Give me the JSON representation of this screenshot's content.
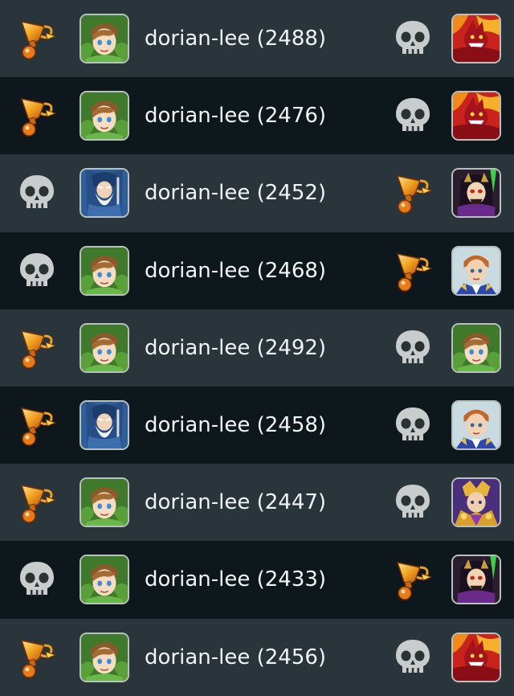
{
  "matches": [
    {
      "player": "dorian-lee (2488)",
      "left_result": "trophy-icon",
      "left_avatar": "green-hair-hero-avatar",
      "right_result": "skull-icon",
      "right_avatar": "red-dragon-avatar"
    },
    {
      "player": "dorian-lee (2476)",
      "left_result": "trophy-icon",
      "left_avatar": "green-hair-hero-avatar",
      "right_result": "skull-icon",
      "right_avatar": "red-dragon-avatar"
    },
    {
      "player": "dorian-lee (2452)",
      "left_result": "skull-icon",
      "left_avatar": "wizard-avatar",
      "right_result": "trophy-icon",
      "right_avatar": "dark-lord-avatar"
    },
    {
      "player": "dorian-lee (2468)",
      "left_result": "skull-icon",
      "left_avatar": "green-hair-hero-avatar",
      "right_result": "trophy-icon",
      "right_avatar": "prince-avatar"
    },
    {
      "player": "dorian-lee (2492)",
      "left_result": "trophy-icon",
      "left_avatar": "green-hair-hero-avatar",
      "right_result": "skull-icon",
      "right_avatar": "green-hair-hero-avatar"
    },
    {
      "player": "dorian-lee (2458)",
      "left_result": "trophy-icon",
      "left_avatar": "wizard-avatar",
      "right_result": "skull-icon",
      "right_avatar": "prince-avatar"
    },
    {
      "player": "dorian-lee (2447)",
      "left_result": "trophy-icon",
      "left_avatar": "green-hair-hero-avatar",
      "right_result": "skull-icon",
      "right_avatar": "golden-knight-avatar"
    },
    {
      "player": "dorian-lee (2433)",
      "left_result": "skull-icon",
      "left_avatar": "green-hair-hero-avatar",
      "right_result": "trophy-icon",
      "right_avatar": "dark-lord-avatar"
    },
    {
      "player": "dorian-lee (2456)",
      "left_result": "trophy-icon",
      "left_avatar": "green-hair-hero-avatar",
      "right_result": "skull-icon",
      "right_avatar": "red-dragon-avatar"
    }
  ],
  "colors": {
    "row_odd": "#29353a",
    "row_even": "#0e181c",
    "text": "#f2f4f4",
    "trophy_gold": "#f0a020",
    "skull_gray": "#c8cccd"
  }
}
